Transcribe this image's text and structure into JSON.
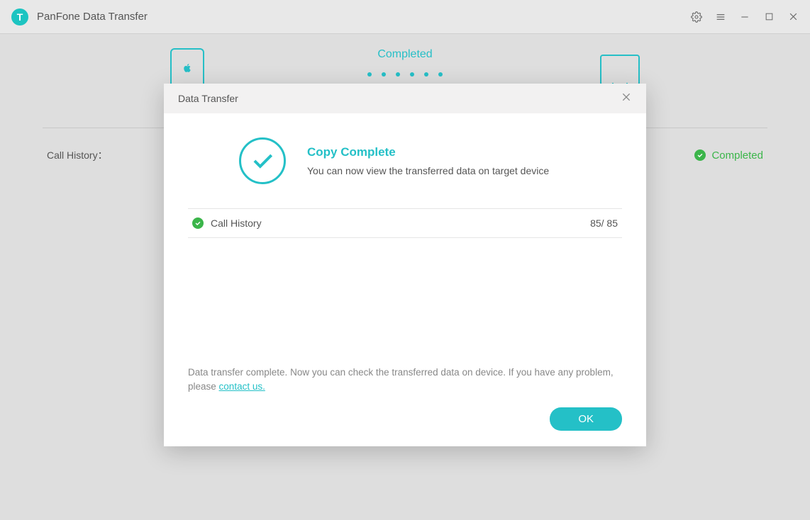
{
  "app": {
    "title": "PanFone Data Transfer",
    "logo_letter": "T"
  },
  "main": {
    "completed_label": "Completed",
    "row_label": "Call History：",
    "row_status": "Completed"
  },
  "modal": {
    "title": "Data Transfer",
    "hero_title": "Copy Complete",
    "hero_subtitle": "You can now view the transferred data on target device",
    "items": [
      {
        "name": "Call History",
        "count": "85/ 85"
      }
    ],
    "footer_text_before": "Data transfer complete. Now you can check the transferred data on device. If you have any problem, please ",
    "footer_link": "contact us.",
    "ok_label": "OK"
  }
}
